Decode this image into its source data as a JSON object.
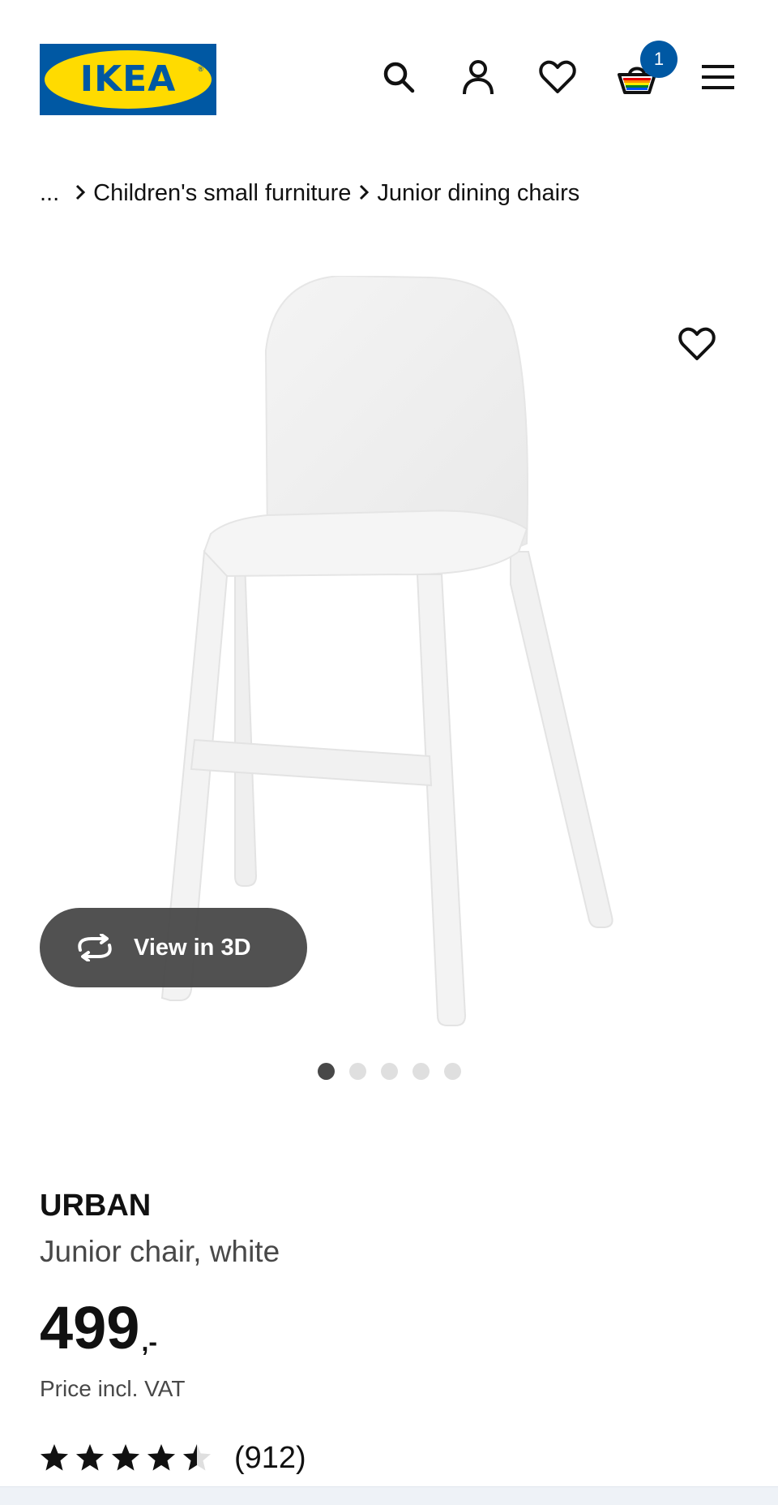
{
  "header": {
    "logo_text": "IKEA",
    "logo_reg": "®",
    "cart_count": "1",
    "icons": [
      "search-icon",
      "account-icon",
      "heart-icon",
      "basket-icon",
      "menu-icon"
    ]
  },
  "breadcrumb": {
    "ellipsis": "...",
    "items": [
      "Children's small furniture",
      "Junior dining chairs"
    ]
  },
  "gallery": {
    "view_3d_label": "View in 3D",
    "image_count": 5,
    "active_index": 0
  },
  "product": {
    "name": "URBAN",
    "description": "Junior chair, white",
    "price_integer": "499",
    "price_suffix": ",-",
    "price_note": "Price incl. VAT",
    "rating": 4.5,
    "review_count": "(912)"
  },
  "colors": {
    "ikea_blue": "#0058a3",
    "ikea_yellow": "#ffdb00",
    "text": "#111111",
    "muted_text": "#484848"
  }
}
